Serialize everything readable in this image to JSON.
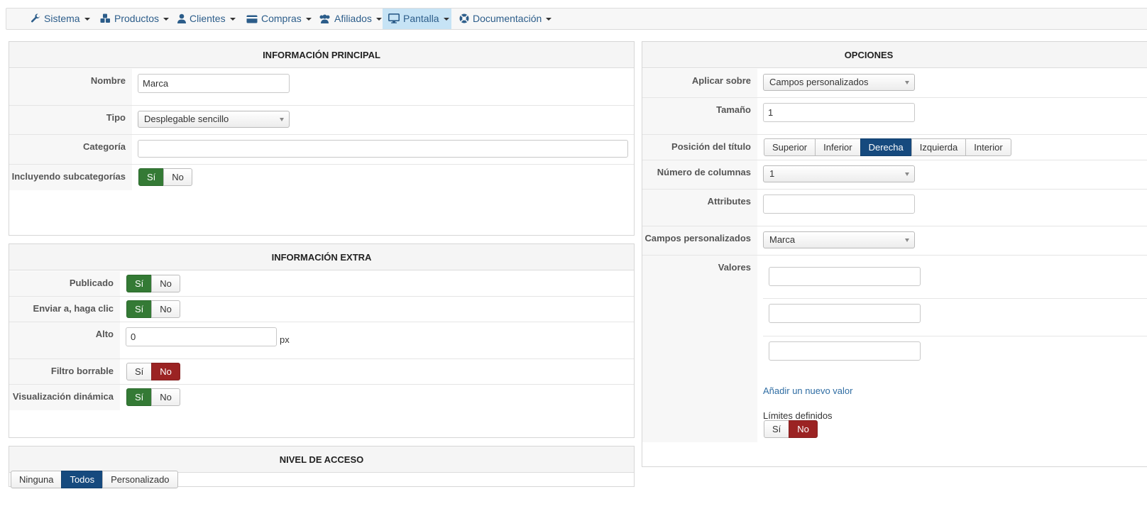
{
  "nav": {
    "items": [
      {
        "label": "Sistema",
        "icon": "wrench-icon"
      },
      {
        "label": "Productos",
        "icon": "cubes-icon"
      },
      {
        "label": "Clientes",
        "icon": "user-icon"
      },
      {
        "label": "Compras",
        "icon": "credit-card-icon"
      },
      {
        "label": "Afiliados",
        "icon": "users-icon"
      },
      {
        "label": "Pantalla",
        "icon": "monitor-icon",
        "active": true
      },
      {
        "label": "Documentación",
        "icon": "life-ring-icon"
      }
    ]
  },
  "main_info": {
    "title": "INFORMACIÓN PRINCIPAL",
    "nombre_label": "Nombre",
    "nombre_value": "Marca",
    "tipo_label": "Tipo",
    "tipo_value": "Desplegable sencillo",
    "categoria_label": "Categoría",
    "categoria_value": "",
    "subcat_label": "Incluyendo subcategorías",
    "subcat_yes": "Sí",
    "subcat_no": "No"
  },
  "extra_info": {
    "title": "INFORMACIÓN EXTRA",
    "publicado_label": "Publicado",
    "enviar_label": "Enviar a, haga clic",
    "alto_label": "Alto",
    "alto_value": "0",
    "alto_unit": "px",
    "filtro_label": "Filtro borrable",
    "visual_label": "Visualización dinámica",
    "yes": "Sí",
    "no": "No"
  },
  "access": {
    "title": "NIVEL DE ACCESO",
    "options": [
      "Ninguna",
      "Todos",
      "Personalizado"
    ],
    "selected": "Todos"
  },
  "options": {
    "title": "OPCIONES",
    "aplicar_label": "Aplicar sobre",
    "aplicar_value": "Campos personalizados",
    "tamano_label": "Tamaño",
    "tamano_value": "1",
    "posicion_label": "Posición del título",
    "posicion_options": [
      "Superior",
      "Inferior",
      "Derecha",
      "Izquierda",
      "Interior"
    ],
    "posicion_selected": "Derecha",
    "columnas_label": "Número de columnas",
    "columnas_value": "1",
    "attributes_label": "Attributes",
    "attributes_value": "",
    "campos_label": "Campos personalizados",
    "campos_value": "Marca",
    "valores_label": "Valores",
    "valores": [
      "",
      "",
      ""
    ],
    "add_value_link": "Añadir un nuevo valor",
    "limites_label": "Límites definidos",
    "yes": "Sí",
    "no": "No"
  },
  "colors": {
    "green": "#347a35",
    "red": "#9b2323",
    "blue": "#164a7e",
    "nav_active": "#c6e3f5",
    "link": "#2f6da3"
  }
}
